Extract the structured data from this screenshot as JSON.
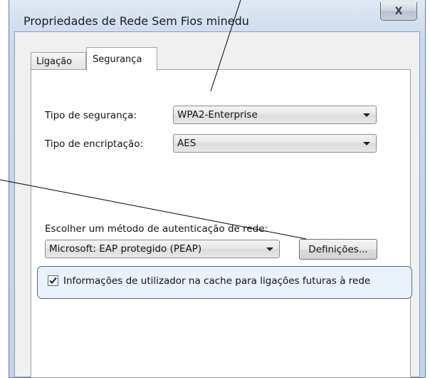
{
  "window": {
    "title": "Propriedades de Rede Sem Fios minedu",
    "close_label": "X"
  },
  "tabs": [
    {
      "label": "Ligação",
      "selected": false
    },
    {
      "label": "Segurança",
      "selected": true
    }
  ],
  "security": {
    "type_label": "Tipo de segurança:",
    "type_value": "WPA2-Enterprise",
    "encryption_label": "Tipo de encriptação:",
    "encryption_value": "AES"
  },
  "auth": {
    "method_label": "Escolher um método de autenticação de rede:",
    "method_value": "Microsoft: EAP protegido (PEAP)",
    "settings_button": "Definições..."
  },
  "cache": {
    "checked": true,
    "label": "Informações de utilizador na cache para ligações futuras à rede"
  },
  "colors": {
    "highlight_border": "#4b6a8f",
    "annotation_line": "#000000"
  }
}
